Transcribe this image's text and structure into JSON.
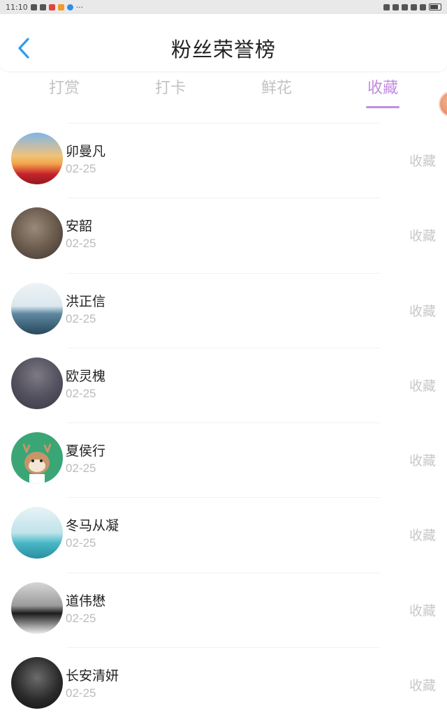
{
  "status_bar": {
    "time": "11:10",
    "more": "···"
  },
  "header": {
    "title": "粉丝荣誉榜"
  },
  "tabs": [
    {
      "label": "打赏",
      "active": false
    },
    {
      "label": "打卡",
      "active": false
    },
    {
      "label": "鲜花",
      "active": false
    },
    {
      "label": "收藏",
      "active": true
    }
  ],
  "colors": {
    "accent": "#c28be0",
    "back_icon": "#2d9cf0",
    "muted": "#c2c2c2"
  },
  "fans": [
    {
      "name": "卯曼凡",
      "date": "02-25",
      "action": "收藏"
    },
    {
      "name": "安韶",
      "date": "02-25",
      "action": "收藏"
    },
    {
      "name": "洪正信",
      "date": "02-25",
      "action": "收藏"
    },
    {
      "name": "欧灵槐",
      "date": "02-25",
      "action": "收藏"
    },
    {
      "name": "夏侯行",
      "date": "02-25",
      "action": "收藏"
    },
    {
      "name": "冬马从凝",
      "date": "02-25",
      "action": "收藏"
    },
    {
      "name": "道伟懋",
      "date": "02-25",
      "action": "收藏"
    },
    {
      "name": "长安清妍",
      "date": "02-25",
      "action": "收藏"
    }
  ]
}
